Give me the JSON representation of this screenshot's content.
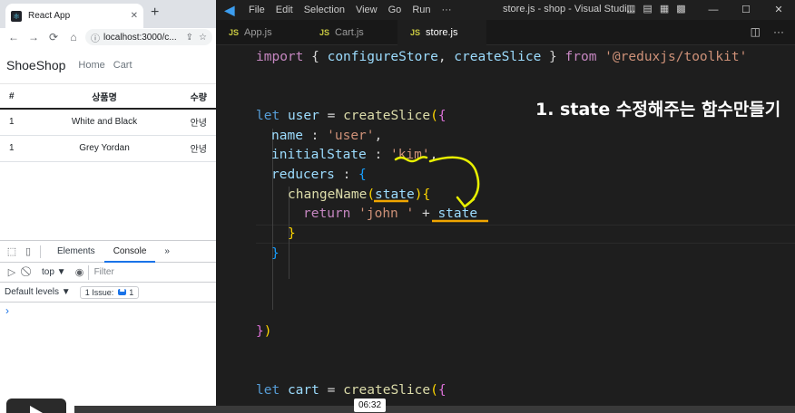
{
  "browser": {
    "tab_title": "React App",
    "tab_close": "✕",
    "new_tab": "+",
    "url": "localhost:3000/c...",
    "nav": {
      "back": "←",
      "forward": "→",
      "reload": "⟳",
      "home": "⌂",
      "lock": "ⓘ",
      "share": "⇪",
      "star": "☆"
    },
    "app": {
      "brand": "ShoeShop",
      "links": [
        "Home",
        "Cart"
      ],
      "table": {
        "headers": [
          "#",
          "상품명",
          "수량"
        ],
        "rows": [
          [
            "1",
            "White and Black",
            "안녕"
          ],
          [
            "1",
            "Grey Yordan",
            "안녕"
          ]
        ]
      }
    },
    "devtools": {
      "tabs": [
        "Elements",
        "Console"
      ],
      "more": "»",
      "context": "top ▼",
      "filter_placeholder": "Filter",
      "levels": "Default levels ▼",
      "issue_label": "1 Issue:",
      "issue_count": "1",
      "prompt": "›"
    }
  },
  "vscode": {
    "logo": "◀",
    "menu": [
      "File",
      "Edit",
      "Selection",
      "View",
      "Go",
      "Run",
      "···"
    ],
    "window_title": "store.js - shop - Visual Studi...",
    "win_controls": [
      "—",
      "☐",
      "✕"
    ],
    "tabs": [
      {
        "icon": "JS",
        "label": "App.js"
      },
      {
        "icon": "JS",
        "label": "Cart.js"
      },
      {
        "icon": "JS",
        "label": "store.js"
      }
    ],
    "code": {
      "l1": [
        "import",
        " { ",
        "configureStore",
        ", ",
        "createSlice",
        " } ",
        "from",
        " ",
        "'@reduxjs/toolkit'"
      ],
      "l2": [
        "let",
        " ",
        "user",
        " = ",
        "createSlice",
        "(",
        "{"
      ],
      "l3": [
        "name",
        " : ",
        "'user'",
        ","
      ],
      "l4": [
        "initialState",
        " : ",
        "'kim'",
        ","
      ],
      "l5": [
        "reducers",
        " : ",
        "{"
      ],
      "l6": [
        "changeName",
        "(",
        "state",
        ")",
        "{"
      ],
      "l7": [
        "return",
        " ",
        "'john '",
        " + ",
        "state"
      ],
      "l8": "}",
      "l9": "}",
      "l10": [
        "}",
        ")"
      ],
      "l11": [
        "let",
        " ",
        "cart",
        " = ",
        "createSlice",
        "(",
        "{"
      ]
    },
    "caption": "1. state 수정해주는 함수만들기"
  },
  "video": {
    "timestamp": "06:32"
  },
  "colors": {
    "annotation_yellow": "#e8f000",
    "annotation_underline": "#f0a500"
  }
}
